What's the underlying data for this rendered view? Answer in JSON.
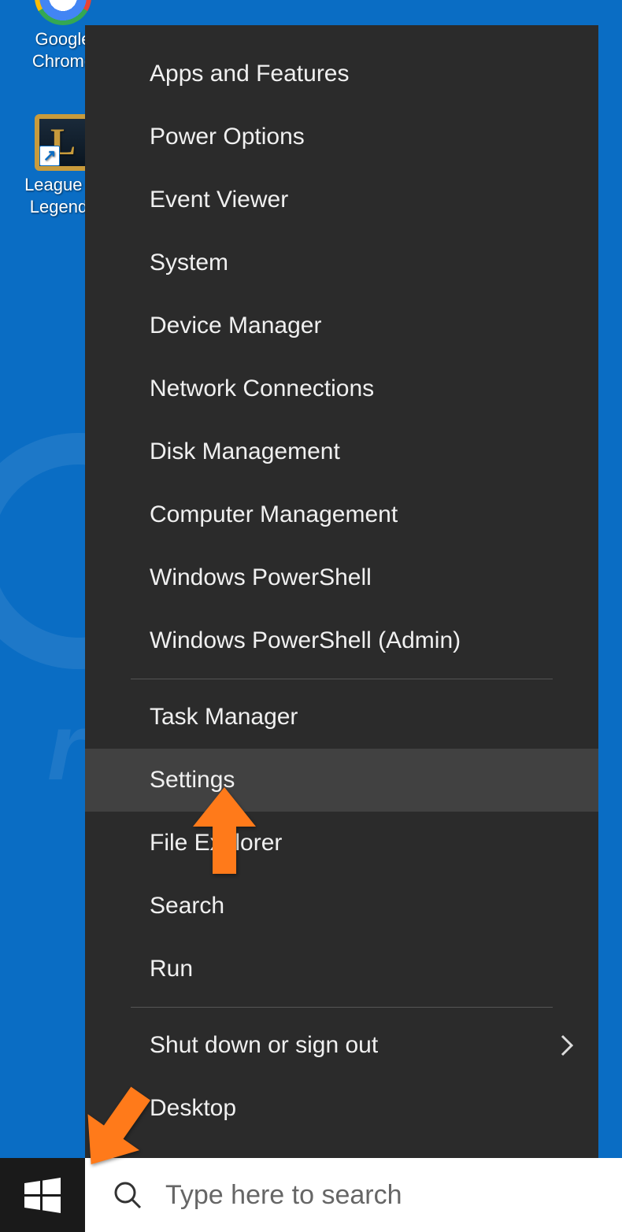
{
  "desktop": {
    "icons": [
      {
        "name": "chrome",
        "label": "Google Chrome"
      },
      {
        "name": "lol",
        "label": "League of Legends",
        "glyph": "L"
      }
    ]
  },
  "winx_menu": {
    "groups": [
      {
        "items": [
          {
            "id": "apps-and-features",
            "label": "Apps and Features",
            "submenu": false
          },
          {
            "id": "power-options",
            "label": "Power Options",
            "submenu": false
          },
          {
            "id": "event-viewer",
            "label": "Event Viewer",
            "submenu": false
          },
          {
            "id": "system",
            "label": "System",
            "submenu": false
          },
          {
            "id": "device-manager",
            "label": "Device Manager",
            "submenu": false
          },
          {
            "id": "network-connections",
            "label": "Network Connections",
            "submenu": false
          },
          {
            "id": "disk-management",
            "label": "Disk Management",
            "submenu": false
          },
          {
            "id": "computer-management",
            "label": "Computer Management",
            "submenu": false
          },
          {
            "id": "windows-powershell",
            "label": "Windows PowerShell",
            "submenu": false
          },
          {
            "id": "windows-powershell-admin",
            "label": "Windows PowerShell (Admin)",
            "submenu": false
          }
        ]
      },
      {
        "items": [
          {
            "id": "task-manager",
            "label": "Task Manager",
            "submenu": false
          },
          {
            "id": "settings",
            "label": "Settings",
            "submenu": false,
            "hover": true
          },
          {
            "id": "file-explorer",
            "label": "File Explorer",
            "submenu": false
          },
          {
            "id": "search",
            "label": "Search",
            "submenu": false
          },
          {
            "id": "run",
            "label": "Run",
            "submenu": false
          }
        ]
      },
      {
        "items": [
          {
            "id": "shut-down-or-sign-out",
            "label": "Shut down or sign out",
            "submenu": true
          },
          {
            "id": "desktop",
            "label": "Desktop",
            "submenu": false
          }
        ]
      }
    ]
  },
  "taskbar": {
    "search_placeholder": "Type here to search"
  },
  "colors": {
    "desktop_bg": "#0a6dc4",
    "menu_bg": "#2b2b2b",
    "menu_hover": "#414141",
    "annotation": "#ff7a1a"
  },
  "annotations": {
    "arrows": [
      {
        "target": "settings-menu-item"
      },
      {
        "target": "start-button"
      }
    ]
  }
}
